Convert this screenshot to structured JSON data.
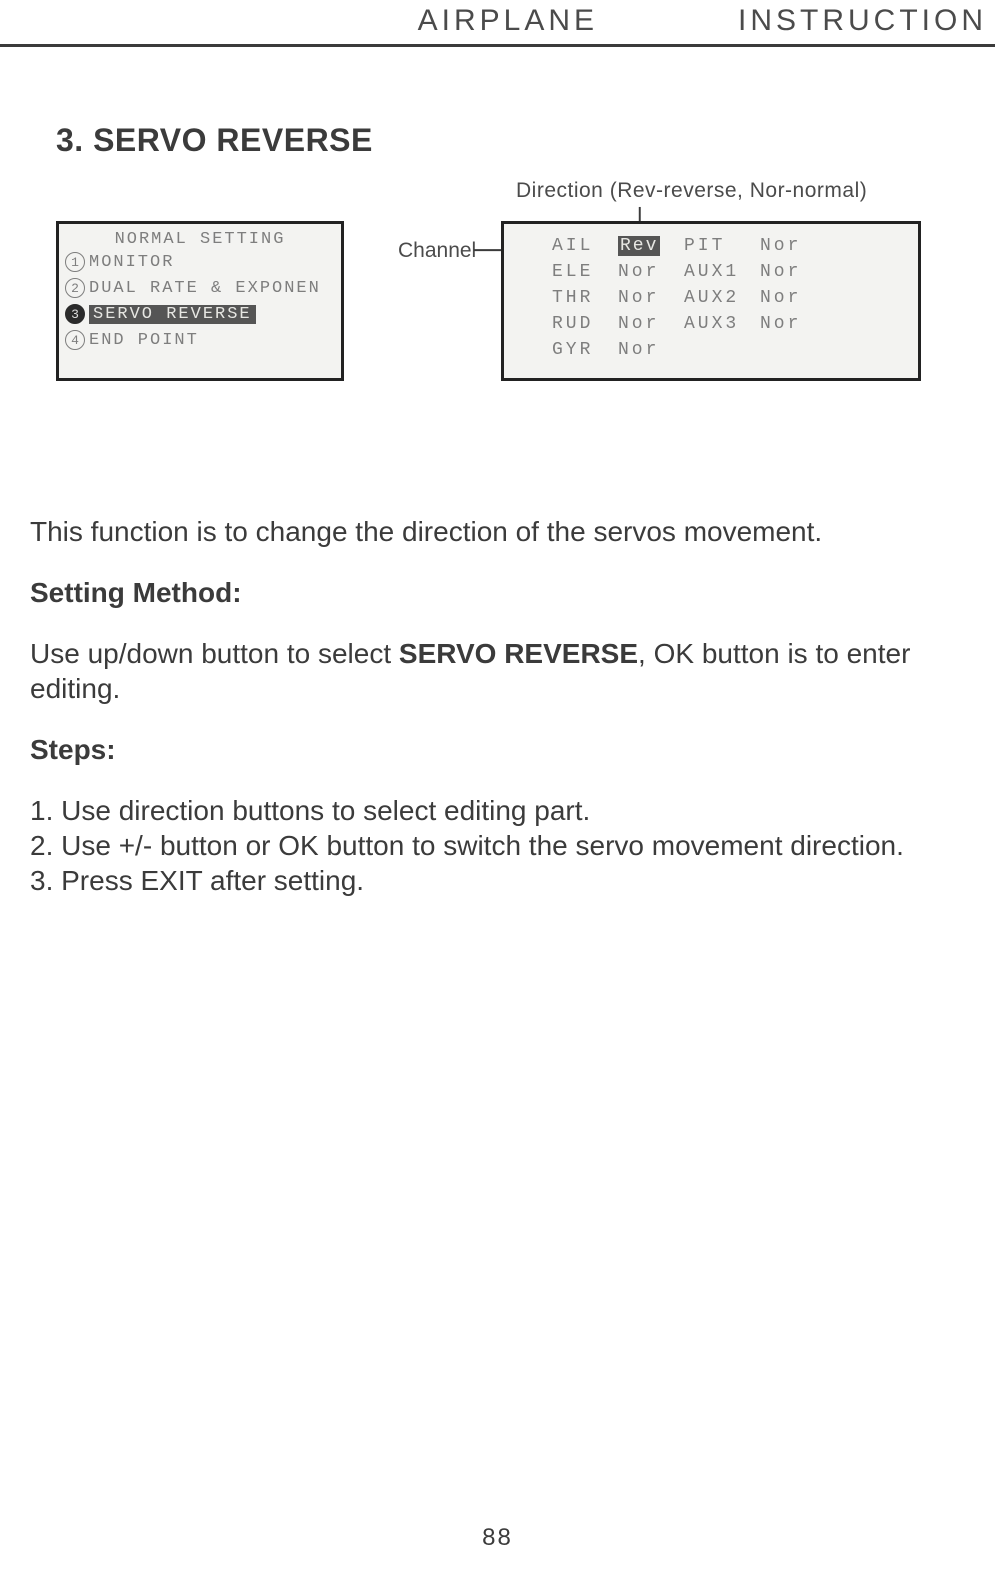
{
  "header": {
    "left": "AIRPLANE",
    "right": "INSTRUCTION"
  },
  "section": {
    "title": "3. SERVO REVERSE"
  },
  "legends": {
    "direction": "Direction (Rev-reverse, Nor-normal)",
    "channel": "Channel"
  },
  "lcd_left": {
    "title": "NORMAL SETTING",
    "items": [
      {
        "num": "1",
        "label": "MONITOR",
        "selected": false
      },
      {
        "num": "2",
        "label": "DUAL RATE & EXPONEN",
        "selected": false
      },
      {
        "num": "3",
        "label": "SERVO REVERSE",
        "selected": true
      },
      {
        "num": "4",
        "label": "END POINT",
        "selected": false
      }
    ]
  },
  "lcd_right": {
    "rows": [
      {
        "c1": "AIL",
        "c2": "Rev",
        "c2_sel": true,
        "c3": "PIT",
        "c4": "Nor"
      },
      {
        "c1": "ELE",
        "c2": "Nor",
        "c2_sel": false,
        "c3": "AUX1",
        "c4": "Nor"
      },
      {
        "c1": "THR",
        "c2": "Nor",
        "c2_sel": false,
        "c3": "AUX2",
        "c4": "Nor"
      },
      {
        "c1": "RUD",
        "c2": "Nor",
        "c2_sel": false,
        "c3": "AUX3",
        "c4": "Nor"
      },
      {
        "c1": "GYR",
        "c2": "Nor",
        "c2_sel": false,
        "c3": "",
        "c4": ""
      }
    ]
  },
  "body": {
    "intro": "This function is to change the direction of the servos movement.",
    "setting_method_heading": "Setting Method:",
    "setting_method_pre": "Use up/down button to select ",
    "setting_method_bold": "SERVO REVERSE",
    "setting_method_post": ", OK button is to enter editing.",
    "steps_heading": "Steps:",
    "steps": [
      "1. Use direction buttons to select editing part.",
      "2. Use +/- button or OK button to switch the servo movement direction.",
      "3. Press EXIT after setting."
    ]
  },
  "page_number": "88"
}
